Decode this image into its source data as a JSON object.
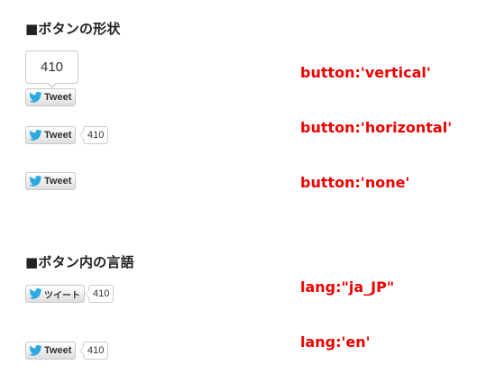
{
  "sections": {
    "shape": {
      "heading": "■ボタンの形状",
      "vertical": {
        "count": "410",
        "button_label": "Tweet",
        "code_label": "button:'vertical'"
      },
      "horizontal": {
        "count": "410",
        "button_label": "Tweet",
        "code_label": "button:'horizontal'"
      },
      "none": {
        "button_label": "Tweet",
        "code_label": "button:'none'"
      }
    },
    "language": {
      "heading": "■ボタン内の言語",
      "ja": {
        "count": "410",
        "button_label": "ツイート",
        "code_label": "lang:\"ja_JP\""
      },
      "en": {
        "count": "410",
        "button_label": "Tweet",
        "code_label": "lang:'en'"
      }
    }
  },
  "colors": {
    "code_label": "#ee0000",
    "twitter_bird": "#2aa9e0",
    "heading": "#222222"
  },
  "icons": {
    "bird": "twitter-bird-icon"
  }
}
